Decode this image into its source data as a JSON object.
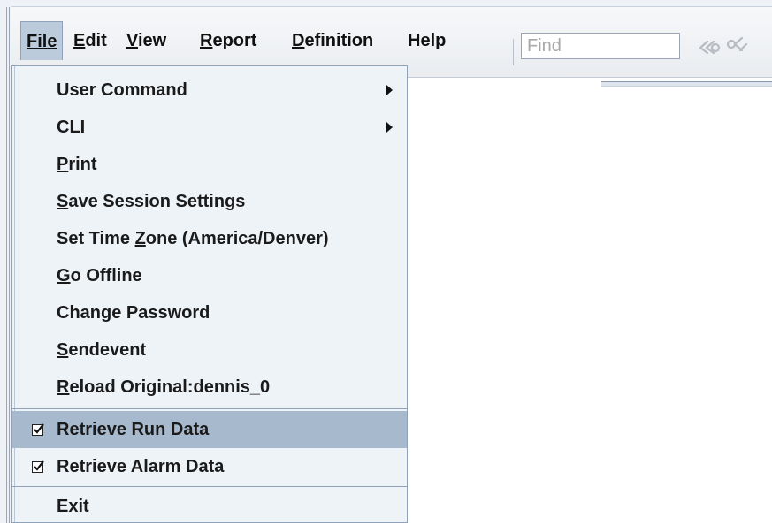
{
  "menubar": {
    "items": [
      {
        "label": "File",
        "mnemonic": "F"
      },
      {
        "label": "Edit",
        "mnemonic": "E"
      },
      {
        "label": "View",
        "mnemonic": "V"
      },
      {
        "label": "Report",
        "mnemonic": "R"
      },
      {
        "label": "Definition",
        "mnemonic": "D"
      },
      {
        "label": "Help",
        "mnemonic": ""
      }
    ]
  },
  "toolbar": {
    "find_placeholder": "Find",
    "icons": [
      "previous-icon",
      "next-icon"
    ]
  },
  "file_menu": {
    "items": [
      {
        "label": "User Command",
        "submenu": true
      },
      {
        "label": "CLI",
        "submenu": true
      },
      {
        "label": "Print",
        "mnemonic": "P"
      },
      {
        "label": "Save Session Settings",
        "mnemonic": "S"
      },
      {
        "label": "Set Time Zone (America/Denver)",
        "mnemonic": "Z"
      },
      {
        "label": "Go Offline",
        "mnemonic": "G"
      },
      {
        "label": "Change Password"
      },
      {
        "label": "Sendevent",
        "mnemonic": "S"
      },
      {
        "label": "Reload Original:dennis_0",
        "mnemonic": "R"
      },
      {
        "label": "Retrieve Run Data",
        "checked": true,
        "highlighted": true
      },
      {
        "label": "Retrieve Alarm Data",
        "checked": true
      },
      {
        "label": "Exit"
      }
    ]
  },
  "colors": {
    "menu_background": "#eef3f8",
    "highlight": "#a6b9cd",
    "border": "#8ea3bb"
  }
}
